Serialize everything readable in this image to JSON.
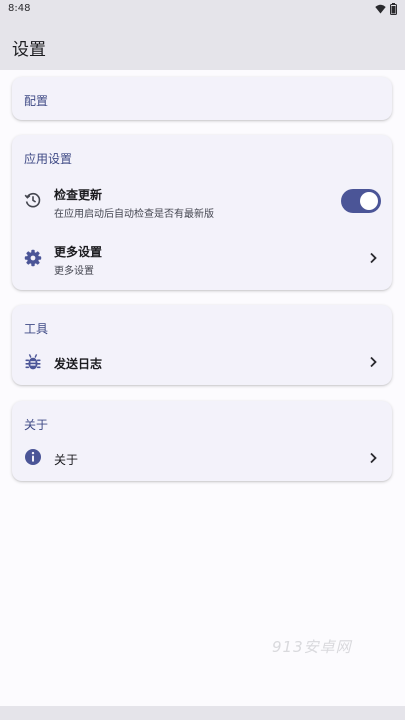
{
  "status": {
    "time": "8:48"
  },
  "appbar": {
    "title": "设置"
  },
  "sections": {
    "config": {
      "title": "配置"
    },
    "app_settings": {
      "title": "应用设置",
      "check_update": {
        "title": "检查更新",
        "subtitle": "在应用启动后自动检查是否有最新版",
        "enabled": true
      },
      "more_settings": {
        "title": "更多设置",
        "subtitle": "更多设置"
      }
    },
    "tools": {
      "title": "工具",
      "send_log": {
        "title": "发送日志"
      }
    },
    "about": {
      "title": "关于",
      "about_item": {
        "title": "关于"
      }
    }
  },
  "watermark": "913安卓网",
  "colors": {
    "accent": "#4b5597",
    "card": "#f3f2fa",
    "section_title": "#3f4a85"
  }
}
